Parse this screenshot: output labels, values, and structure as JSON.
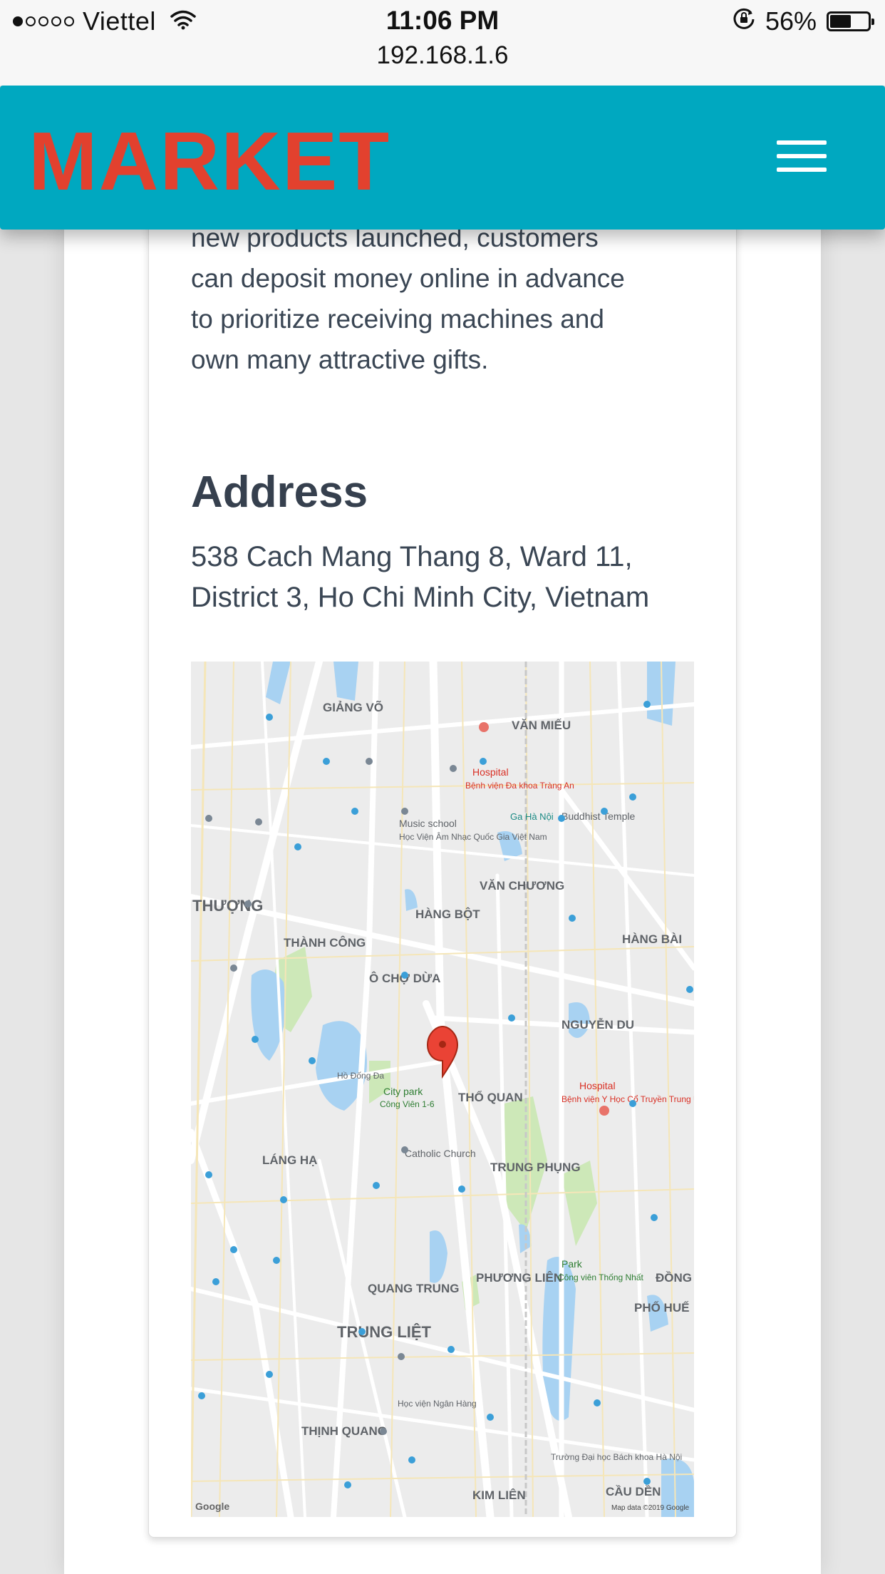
{
  "status_bar": {
    "carrier": "Viettel",
    "time": "11:06 PM",
    "url": "192.168.1.6",
    "battery": "56%",
    "battery_level": 0.56
  },
  "header": {
    "logo": "MARKET"
  },
  "content": {
    "body_text": "new products launched, customers can deposit money online in advance to prioritize receiving machines and own many attractive gifts.",
    "address_title": "Address",
    "address_text": "538 Cach Mang Thang 8, Ward 11, District 3, Ho Chi Minh City, Vietnam"
  },
  "map": {
    "districts": [
      "GIẢNG VÕ",
      "VĂN MIẾU",
      "VĂN CHƯƠNG",
      "HÀNG BỘT",
      "HÀNG BÀI",
      "THÀNH CÔNG",
      "Ô CHỢ DỪA",
      "NGUYỄN DU",
      "THỔ QUAN",
      "LÁNG HẠ",
      "TRUNG PHỤNG",
      "QUANG TRUNG",
      "PHƯƠNG LIÊN",
      "TRUNG LIỆT",
      "THỊNH QUANG",
      "KIM LIÊN",
      "CẦU DỀN",
      "THƯỢNG",
      "PHỐ HUẾ",
      "ĐỒNG XUÂN"
    ],
    "pois": [
      "Hospital",
      "Bệnh viện Đa khoa Tràng An",
      "Music school",
      "Học Viện Âm Nhạc Quốc Gia Việt Nam",
      "Buddhist Temple",
      "City park",
      "Công Viên 1-6",
      "Catholic Church",
      "Hospital",
      "Bệnh viện Y Học Cổ Truyền Trung Ương",
      "Park",
      "Công viên Thống Nhất",
      "Ga Hà Nội",
      "Học viện Ngân Hàng",
      "Trường Đại học Bách khoa Hà Nội",
      "Hồ Đống Đa"
    ],
    "attribution": "Google",
    "copyright": "Map data ©2019 Google"
  }
}
